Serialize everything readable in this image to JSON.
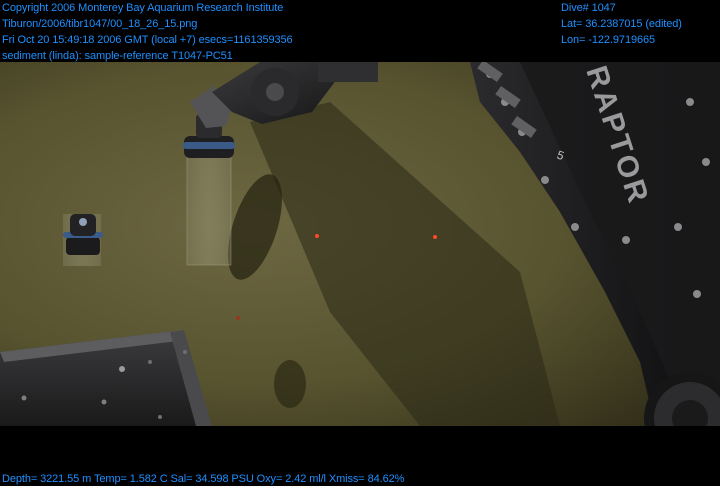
{
  "header_left": {
    "copyright": "Copyright 2006 Monterey Bay Aquarium Research Institute",
    "file_path": "Tiburon/2006/tibr1047/00_18_26_15.png",
    "timestamp": "Fri Oct 20 15:49:18 2006 GMT (local +7)  esecs=1161359356",
    "annotation": "sediment (linda): sample-reference T1047-PC51"
  },
  "header_right": {
    "dive": "Dive# 1047",
    "latitude": "Lat= 36.2387015 (edited)",
    "longitude": "Lon= -122.9719665"
  },
  "footer": {
    "telemetry": "Depth= 3221.55 m  Temp= 1.582 C  Sal= 34.598 PSU  Oxy= 2.42 ml/l  Xmiss= 84.62%"
  },
  "scene": {
    "vehicle_label": "RAPTOR",
    "vehicle_number": "5"
  },
  "colors": {
    "overlay_text": "#1E90FF",
    "seafloor": "#5f5a38",
    "letterbox": "#000000"
  }
}
